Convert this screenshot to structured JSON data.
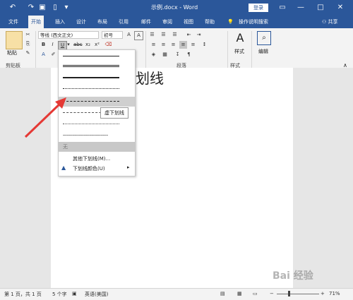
{
  "titlebar": {
    "title": "示例.docx  -  Word",
    "login": "登录",
    "undo_icon": "undo-icon",
    "redo_icon": "redo-icon",
    "save_icon": "save-icon"
  },
  "tabs": [
    "文件",
    "开始",
    "插入",
    "设计",
    "布局",
    "引用",
    "邮件",
    "审阅",
    "视图",
    "帮助"
  ],
  "tell_me": "操作说明搜索",
  "share": "共享",
  "ribbon": {
    "clipboard": {
      "paste": "粘贴",
      "label": "剪贴板"
    },
    "font": {
      "name": "等线 (西文正文)",
      "size": "初号"
    },
    "paragraph": {
      "label": "段落"
    },
    "styles": {
      "button": "样式",
      "label": "样式"
    },
    "editing": {
      "button": "编辑"
    }
  },
  "document": {
    "text": "个划线"
  },
  "underline_menu": {
    "tooltip": "虚下划线",
    "none_label": "无",
    "more": "其他下划线(M)...",
    "color": "下划线颜色(U)"
  },
  "statusbar": {
    "page": "第 1 页，共 1 页",
    "words": "5 个字",
    "language": "英语(美国)",
    "zoom": "71%",
    "zoom_minus": "−",
    "zoom_plus": "+"
  },
  "watermark": "Bai 经验",
  "colors": {
    "accent": "#2b579a",
    "arrow": "#e53935"
  }
}
